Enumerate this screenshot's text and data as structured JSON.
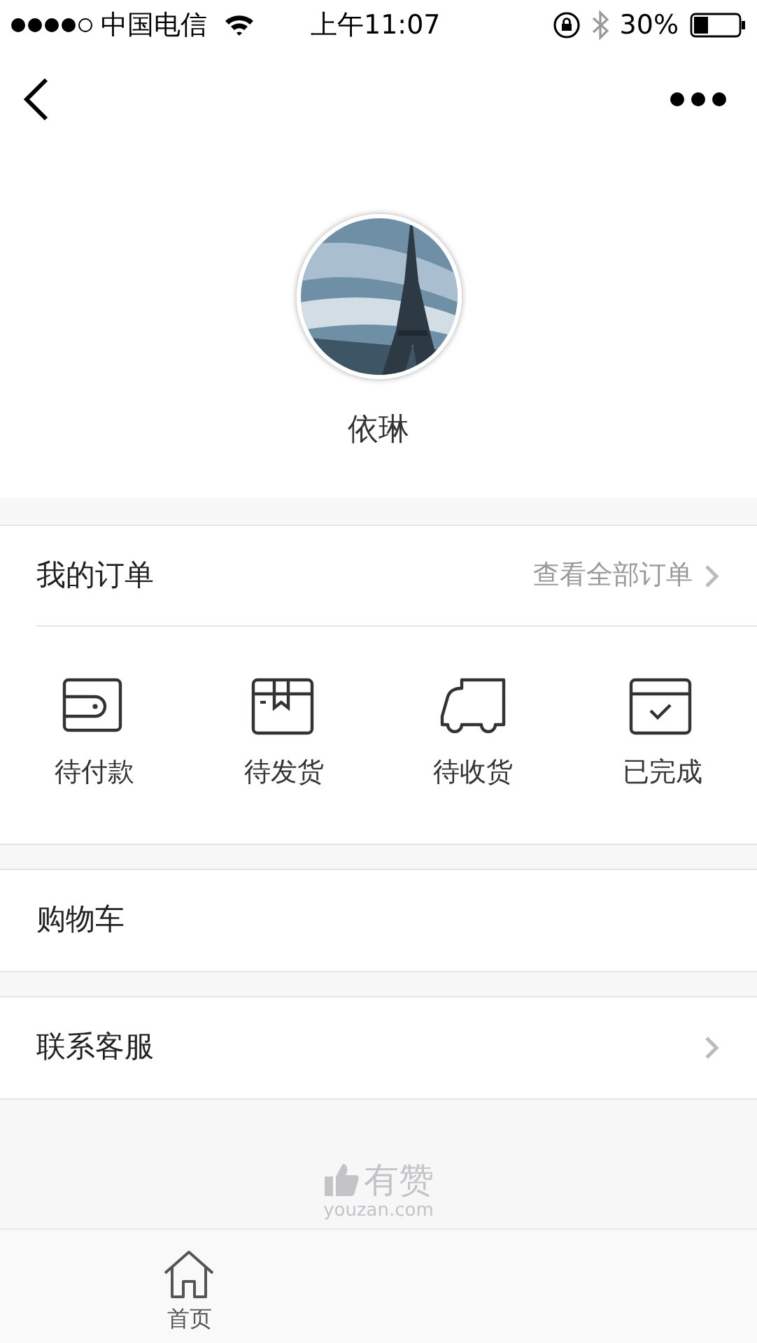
{
  "status_bar": {
    "carrier": "中国电信",
    "time": "上午11:07",
    "battery": "30%"
  },
  "profile": {
    "name": "依琳"
  },
  "orders": {
    "title": "我的订单",
    "link": "查看全部订单",
    "states": [
      {
        "kind": "wallet",
        "label": "待付款"
      },
      {
        "kind": "box",
        "label": "待发货"
      },
      {
        "kind": "truck",
        "label": "待收货"
      },
      {
        "kind": "done",
        "label": "已完成"
      }
    ]
  },
  "menu": [
    {
      "label": "购物车",
      "chevron": false
    },
    {
      "label": "联系客服",
      "chevron": true
    }
  ],
  "footer": {
    "brand": "有赞",
    "domain": "youzan.com"
  },
  "tab_bar": [
    {
      "kind": "home",
      "label": "首页",
      "selected": false
    }
  ]
}
